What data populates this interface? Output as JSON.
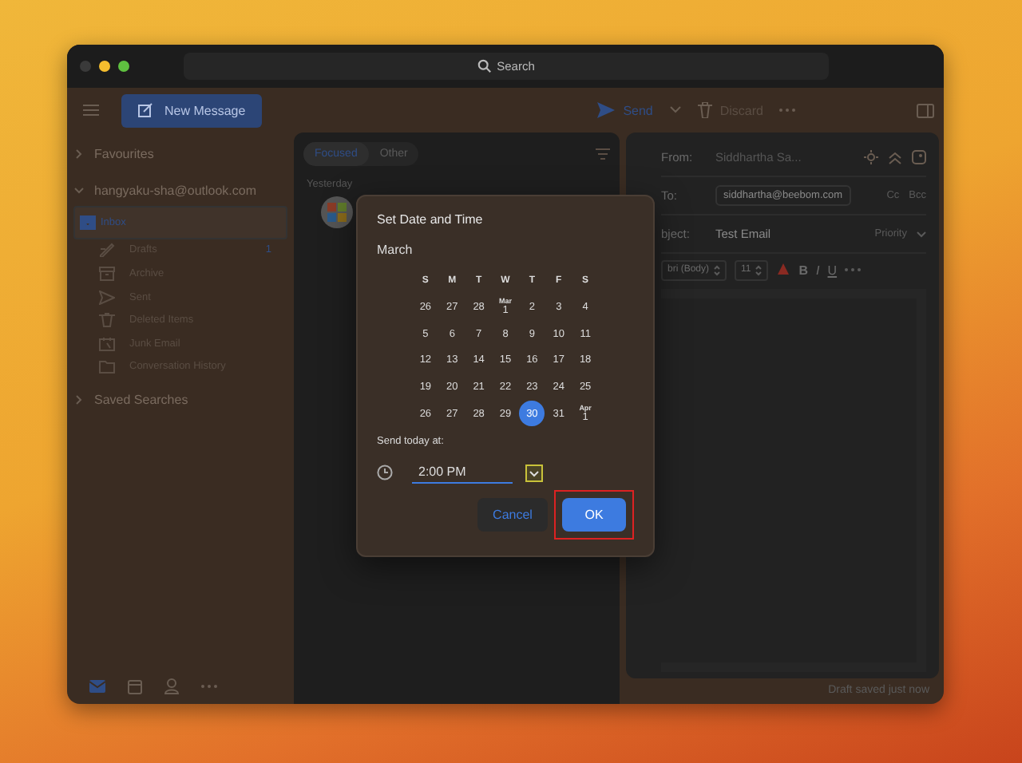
{
  "window": {
    "search_placeholder": "Search"
  },
  "toolbar": {
    "new_message": "New Message",
    "send": "Send",
    "discard": "Discard"
  },
  "sidebar": {
    "groups": [
      {
        "label": "Favourites",
        "expanded": false
      },
      {
        "label": "hangyaku-sha@outlook.com",
        "expanded": true,
        "children": [
          {
            "kind": "inbox",
            "label": "Inbox",
            "selected": true
          },
          {
            "kind": "drafts",
            "label": "Drafts",
            "count": "1",
            "selected": false
          },
          {
            "kind": "archive",
            "label": "Archive",
            "selected": false
          },
          {
            "kind": "sent",
            "label": "Sent",
            "selected": false
          },
          {
            "kind": "trash",
            "label": "Deleted Items",
            "selected": false
          },
          {
            "kind": "junk",
            "label": "Junk Email",
            "selected": false
          },
          {
            "kind": "folder",
            "label": "Conversation History",
            "selected": false
          }
        ]
      },
      {
        "label": "Saved Searches",
        "expanded": false
      }
    ],
    "nav": [
      {
        "kind": "mail",
        "selected": true
      },
      {
        "kind": "calendar",
        "selected": false
      },
      {
        "kind": "people",
        "selected": false
      },
      {
        "kind": "more",
        "selected": false
      }
    ]
  },
  "message_list": {
    "tabs": [
      {
        "label": "Focused",
        "selected": true
      },
      {
        "label": "Other",
        "selected": false
      }
    ],
    "group": "Yesterday"
  },
  "compose": {
    "from_label": "From:",
    "from": "Siddhartha Sa...",
    "to_label": "To:",
    "recipient": "siddhartha@beebom.com",
    "cc": "Cc",
    "bcc": "Bcc",
    "subject_label": "bject:",
    "subject": "Test Email",
    "priority": "Priority",
    "font": "bri (Body)",
    "size": "11",
    "bold": "B",
    "italic": "I",
    "underline": "U",
    "status": "Draft saved just now"
  },
  "dialog": {
    "title": "Set Date and Time",
    "month": "March",
    "weekdays": [
      "S",
      "M",
      "T",
      "W",
      "T",
      "F",
      "S"
    ],
    "weeks": [
      [
        {
          "day": "26",
          "selected": false
        },
        {
          "day": "27",
          "selected": false
        },
        {
          "day": "28",
          "selected": false
        },
        {
          "month": "Mar",
          "day": "1",
          "selected": false
        },
        {
          "day": "2",
          "selected": false
        },
        {
          "day": "3",
          "selected": false
        },
        {
          "day": "4",
          "selected": false
        }
      ],
      [
        {
          "day": "5",
          "selected": false
        },
        {
          "day": "6",
          "selected": false
        },
        {
          "day": "7",
          "selected": false
        },
        {
          "day": "8",
          "selected": false
        },
        {
          "day": "9",
          "selected": false
        },
        {
          "day": "10",
          "selected": false
        },
        {
          "day": "11",
          "selected": false
        }
      ],
      [
        {
          "day": "12",
          "selected": false
        },
        {
          "day": "13",
          "selected": false
        },
        {
          "day": "14",
          "selected": false
        },
        {
          "day": "15",
          "selected": false
        },
        {
          "day": "16",
          "selected": false
        },
        {
          "day": "17",
          "selected": false
        },
        {
          "day": "18",
          "selected": false
        }
      ],
      [
        {
          "day": "19",
          "selected": false
        },
        {
          "day": "20",
          "selected": false
        },
        {
          "day": "21",
          "selected": false
        },
        {
          "day": "22",
          "selected": false
        },
        {
          "day": "23",
          "selected": false
        },
        {
          "day": "24",
          "selected": false
        },
        {
          "day": "25",
          "selected": false
        }
      ],
      [
        {
          "day": "26",
          "selected": false
        },
        {
          "day": "27",
          "selected": false
        },
        {
          "day": "28",
          "selected": false
        },
        {
          "day": "29",
          "selected": false
        },
        {
          "day": "30",
          "selected": true
        },
        {
          "day": "31",
          "selected": false
        },
        {
          "month": "Apr",
          "day": "1",
          "selected": false
        }
      ]
    ],
    "send_label": "Send today at:",
    "time": "2:00 PM",
    "cancel": "Cancel",
    "ok": "OK",
    "ok_highlighted": true
  }
}
